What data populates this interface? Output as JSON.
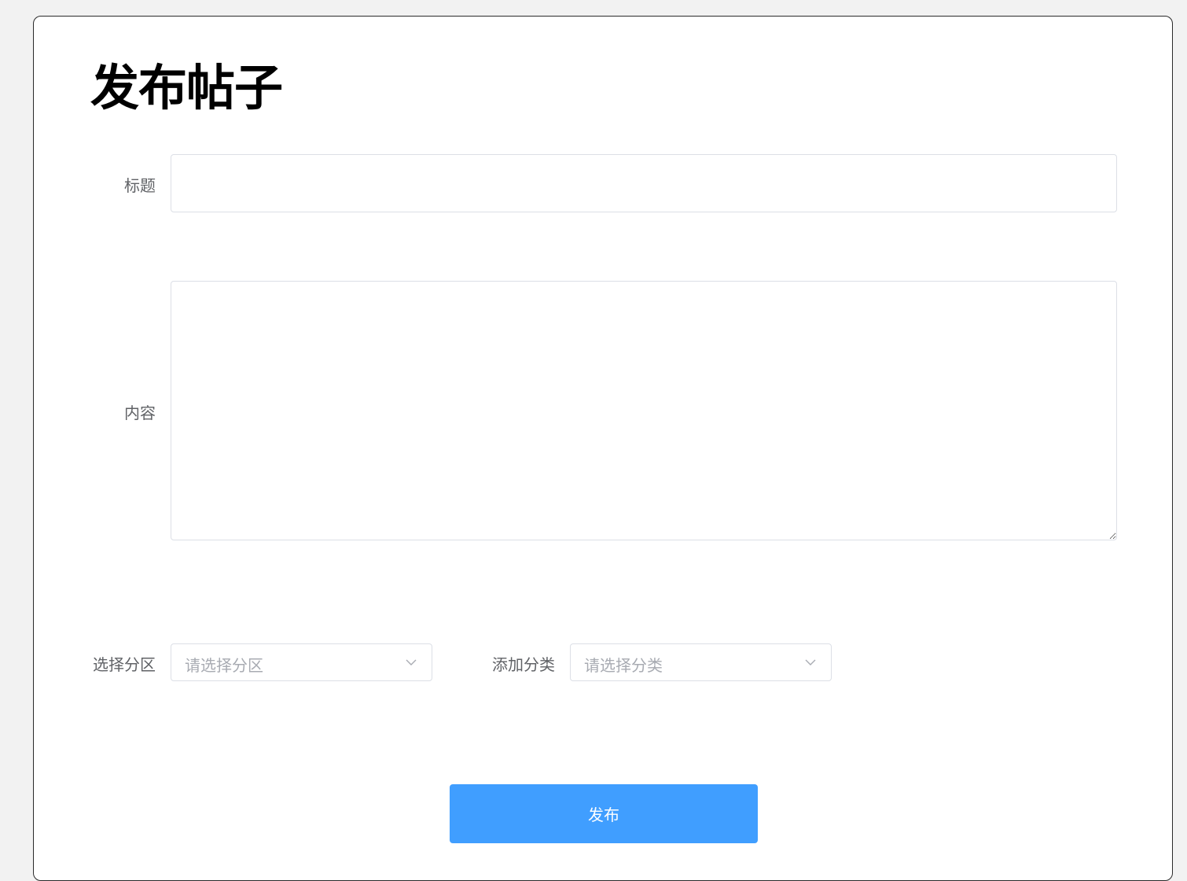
{
  "page": {
    "title": "发布帖子"
  },
  "form": {
    "title_label": "标题",
    "title_value": "",
    "content_label": "内容",
    "content_value": "",
    "section_label": "选择分区",
    "section_placeholder": "请选择分区",
    "category_label": "添加分类",
    "category_placeholder": "请选择分类",
    "submit_label": "发布"
  },
  "colors": {
    "primary": "#409eff",
    "border": "#dcdfe6",
    "label": "#606266",
    "placeholder": "#a8abb2"
  },
  "icons": {
    "select_arrow": "chevron-down-icon"
  }
}
